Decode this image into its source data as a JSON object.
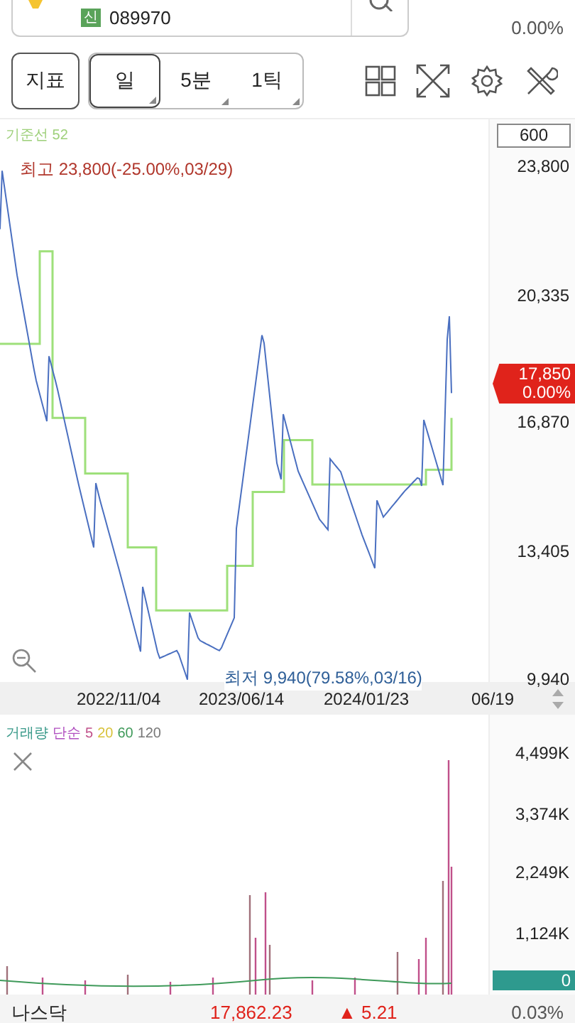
{
  "header": {
    "badge": "신",
    "code": "089970",
    "change": "0.00%"
  },
  "toolbar": {
    "indicator_button": "지표",
    "periods": [
      {
        "label": "일",
        "selected": true
      },
      {
        "label": "5분",
        "selected": false
      },
      {
        "label": "1틱",
        "selected": false
      }
    ]
  },
  "chart": {
    "baseline_label": "기준선 52",
    "scale_box": "600",
    "high_label": "최고 23,800(-25.00%,03/29)",
    "low_label": "최저 9,940(79.58%,03/16)",
    "price_ticks": [
      "23,800",
      "20,335",
      "16,870",
      "13,405",
      "9,940"
    ],
    "current_price": "17,850",
    "current_change": "0.00%",
    "dates": [
      "2022/11/04",
      "2023/06/14",
      "2024/01/23",
      "06/19"
    ]
  },
  "volume": {
    "legend": [
      {
        "text": "거래량",
        "color": "#3a9a8a"
      },
      {
        "text": "단순",
        "color": "#b04fc0"
      },
      {
        "text": "5",
        "color": "#c0508a"
      },
      {
        "text": "20",
        "color": "#d8c23a"
      },
      {
        "text": "60",
        "color": "#3f9a5a"
      },
      {
        "text": "120",
        "color": "#777777"
      }
    ],
    "ticks": [
      "4,499K",
      "3,374K",
      "2,249K",
      "1,124K"
    ],
    "zero": "0"
  },
  "ticker": {
    "name": "나스닥",
    "value": "17,862.23",
    "change": "▲ 5.21",
    "percent": "0.03%"
  }
}
